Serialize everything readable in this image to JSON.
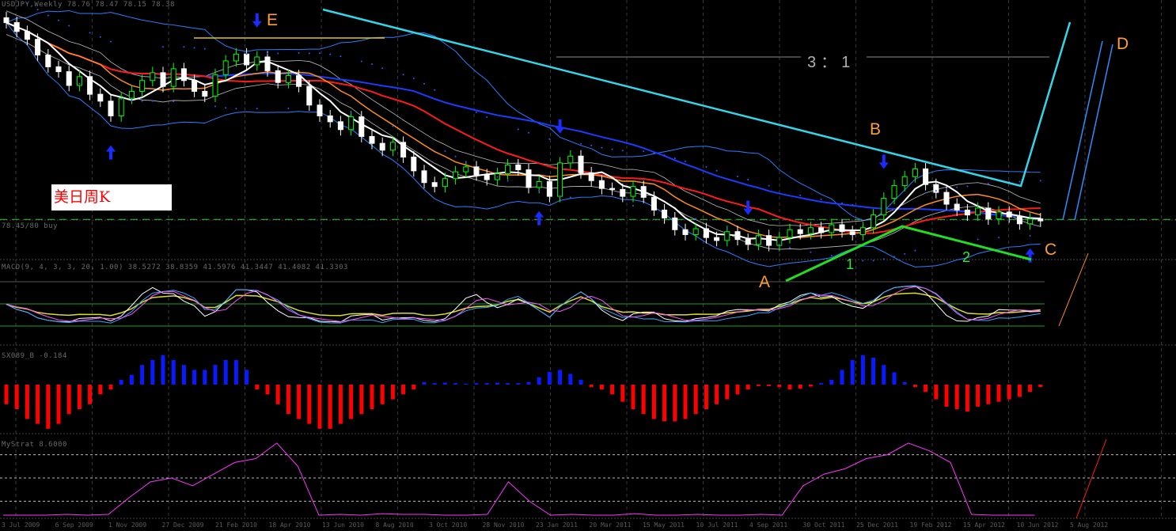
{
  "header": {
    "symbol_info": "USDJPY,Weekly 78.76 78.47 78.15 78.38",
    "level_label": "78.45/80 buy",
    "osc_label": "MACD(9, 4, 3, 3, 20, 1.00) 38.5272 38.8359 41.5976 41.3447 41.4082 41.3303",
    "hist_label": "SX089_B -0.184",
    "bottom_label": "MyStrat 8.6000"
  },
  "annotation": {
    "title_box": "美日周K",
    "E": "E",
    "B": "B",
    "A": "A",
    "C": "C",
    "D": "D",
    "one": "1",
    "two": "2",
    "ratio": "3：1"
  },
  "colors": {
    "bull": "#00ff00",
    "bear": "#ffffff",
    "ma_fast": "#ffffff",
    "ma_mid": "#ff8c1a",
    "ma_slow": "#ff1a1a",
    "ma_long": "#1a3cff",
    "band": "#2a7fff",
    "trend": "#33d6e8",
    "hist_pos": "#0a1aff",
    "hist_neg": "#ff0000",
    "osc": "#ff33ff"
  },
  "chart_data": [
    {
      "type": "candlestick",
      "title": "USDJPY Weekly",
      "ylim": [
        75,
        100
      ],
      "closes": [
        98.5,
        97.6,
        96.8,
        95.2,
        94.0,
        93.5,
        92.1,
        93.0,
        91.2,
        90.5,
        89.0,
        90.8,
        91.5,
        92.6,
        93.4,
        92.0,
        93.8,
        92.6,
        91.5,
        91.0,
        93.2,
        94.6,
        95.3,
        94.2,
        95.0,
        93.6,
        92.4,
        93.1,
        92.0,
        90.1,
        89.0,
        88.4,
        87.6,
        88.9,
        86.9,
        86.2,
        85.5,
        86.3,
        84.8,
        83.4,
        82.2,
        81.8,
        82.6,
        83.3,
        83.8,
        83.0,
        82.5,
        83.1,
        84.0,
        83.5,
        81.7,
        82.3,
        80.8,
        84.2,
        84.9,
        83.2,
        82.4,
        81.6,
        81.5,
        80.8,
        81.8,
        80.7,
        79.4,
        78.6,
        77.4,
        76.9,
        77.5,
        76.6,
        76.3,
        77.2,
        76.4,
        75.9,
        76.8,
        75.8,
        76.6,
        77.4,
        77.0,
        77.6,
        77.1,
        77.9,
        77.2,
        76.9,
        77.6,
        78.9,
        80.6,
        81.9,
        82.8,
        83.6,
        82.0,
        81.2,
        80.0,
        79.4,
        78.9,
        79.6,
        78.5,
        79.2,
        78.7,
        78.0,
        78.5,
        78.3
      ],
      "level": 78.45,
      "up_arrows": [
        10,
        51,
        98
      ],
      "down_arrows": [
        24,
        53,
        84,
        71
      ],
      "xticks": [
        "3 Jul 2009",
        "6 Sep 2009",
        "1 Nov 2009",
        "27 Dec 2009",
        "21 Feb 2010",
        "18 Apr 2010",
        "13 Jun 2010",
        "8 Aug 2010",
        "3 Oct 2010",
        "28 Nov 2010",
        "23 Jan 2011",
        "20 Mar 2011",
        "15 May 2011",
        "10 Jul 2011",
        "4 Sep 2011",
        "30 Oct 2011",
        "25 Dec 2011",
        "19 Feb 2012",
        "15 Apr 2012",
        "10 Jun 2012",
        "5 Aug 2012"
      ]
    },
    {
      "type": "bar",
      "title": "SX089_B",
      "values": [
        -4,
        -5,
        -7,
        -8,
        -9,
        -8,
        -6,
        -5,
        -4,
        -2,
        -1,
        1,
        2,
        4,
        5,
        6,
        5,
        4,
        3,
        3,
        4,
        5,
        5,
        3,
        -1,
        -2,
        -4,
        -6,
        -7,
        -8,
        -9,
        -9,
        -8,
        -7,
        -6,
        -5,
        -4,
        -3,
        -2,
        -1,
        0.5,
        0.3,
        0.4,
        0.3,
        0.2,
        0.3,
        0.3,
        0.4,
        0.3,
        0.3,
        0.5,
        1.5,
        2.6,
        3.0,
        2.2,
        1,
        -0.5,
        -1,
        -2,
        -3.5,
        -5,
        -6,
        -7,
        -7.5,
        -7.5,
        -7,
        -6,
        -5,
        -4,
        -3,
        -2,
        -1,
        -0.3,
        -0.3,
        -0.5,
        -1,
        -0.8,
        -0.4,
        0.3,
        1,
        3,
        5,
        6,
        5.5,
        4,
        2.5,
        0.5,
        -0.5,
        -1.5,
        -3,
        -4.5,
        -5,
        -5.5,
        -4.5,
        -4,
        -3.5,
        -3,
        -2.5,
        -1.5,
        -0.5
      ],
      "ylim": [
        -10,
        7
      ]
    },
    {
      "type": "line",
      "title": "MyStrat",
      "values": [
        2,
        2,
        2,
        3,
        2,
        3,
        25,
        45,
        50,
        40,
        55,
        70,
        75,
        95,
        65,
        2,
        3,
        2,
        4,
        3,
        3,
        2,
        2,
        3,
        45,
        20,
        2,
        3,
        2,
        2,
        4,
        2,
        2,
        3,
        2,
        2,
        3,
        2,
        40,
        55,
        62,
        75,
        80,
        95,
        85,
        70,
        3,
        2,
        2,
        2
      ],
      "ylim": [
        0,
        100
      ],
      "levels": [
        20,
        50,
        80
      ]
    }
  ]
}
